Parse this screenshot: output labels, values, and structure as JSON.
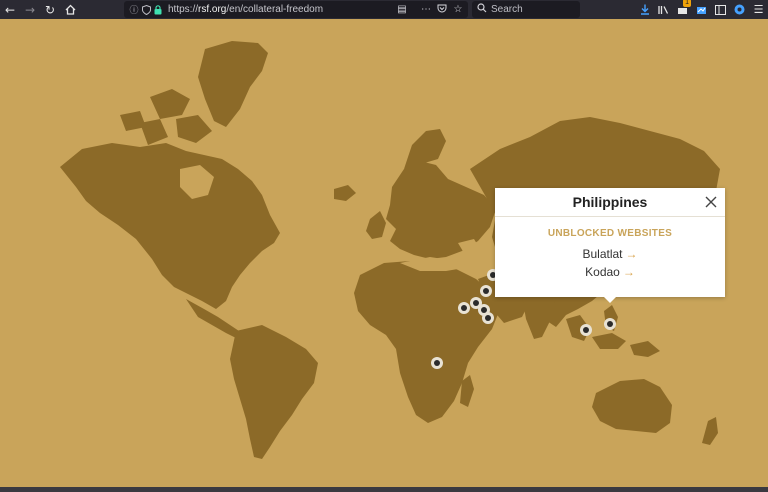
{
  "browser": {
    "url_prefix": "https://",
    "url_domain": "rsf.org",
    "url_path": "/en/collateral-freedom",
    "search_placeholder": "Search",
    "badge_count": "1",
    "icons": {
      "back": "back-arrow-icon",
      "forward": "forward-arrow-icon",
      "reload": "reload-icon",
      "home": "home-icon",
      "info": "info-icon",
      "tracking": "shield-icon",
      "lock": "lock-icon",
      "reader": "reader-view-icon",
      "more": "more-icon",
      "pocket": "pocket-icon",
      "bookmark": "star-icon",
      "download": "download-icon",
      "library": "library-icon",
      "sidebar": "sidebar-icon",
      "menu": "hamburger-menu-icon"
    }
  },
  "colors": {
    "ocean": "#c9a45a",
    "land": "#8c6a28",
    "accent": "#c9a45a",
    "marker": "#2b2b2b"
  },
  "popup": {
    "country": "Philippines",
    "subtitle": "UNBLOCKED WEBSITES",
    "links": [
      {
        "label": "Bulatlat",
        "arrow": "→"
      },
      {
        "label": "Kodao",
        "arrow": "→"
      }
    ]
  }
}
